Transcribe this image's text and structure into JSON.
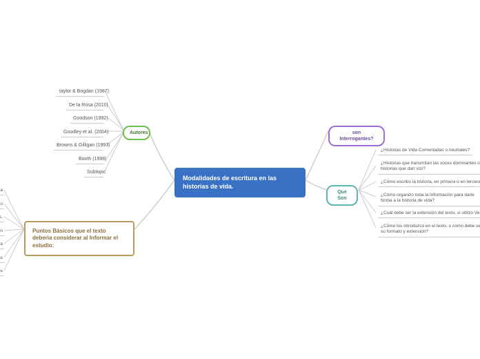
{
  "central": "Modalidades de escritura en las historias de vida.",
  "branches": {
    "autores": {
      "label": "Autores",
      "items": [
        "taylor & Bogdan (1987)",
        "De la Rosa (2010)",
        "Goodson (1992)",
        "Goodley et al. (2004)",
        "Browns & Gilligan (1993)",
        "Booth (1998)",
        "Subtopic"
      ]
    },
    "interrogantes": {
      "label": "son Interrogantes?"
    },
    "queson": {
      "label": "Que Son",
      "items": [
        "¿Historias de Vida Comentadas o neutrales?",
        "¿Historias que transmitan las voces dominantes o historias que dan voz?",
        "¿Cómo escribo la historia, en primera o en tercera persona?",
        "¿Cómo organizo toda la información para darle forma a la historia de vida?",
        "¿Cuál debe ser la extensión del texto, si utilizo Verbatim?",
        "¿Cómo los introduzco en el texto, o como debe ser su formato y extensión?"
      ]
    },
    "puntos": {
      "label": "Puntos Bàsicos que el texto deberìa considerar al Informar el estudio:",
      "items": [
        "da",
        "lo",
        "s.",
        "ón",
        "ra",
        "as",
        "os"
      ]
    }
  }
}
